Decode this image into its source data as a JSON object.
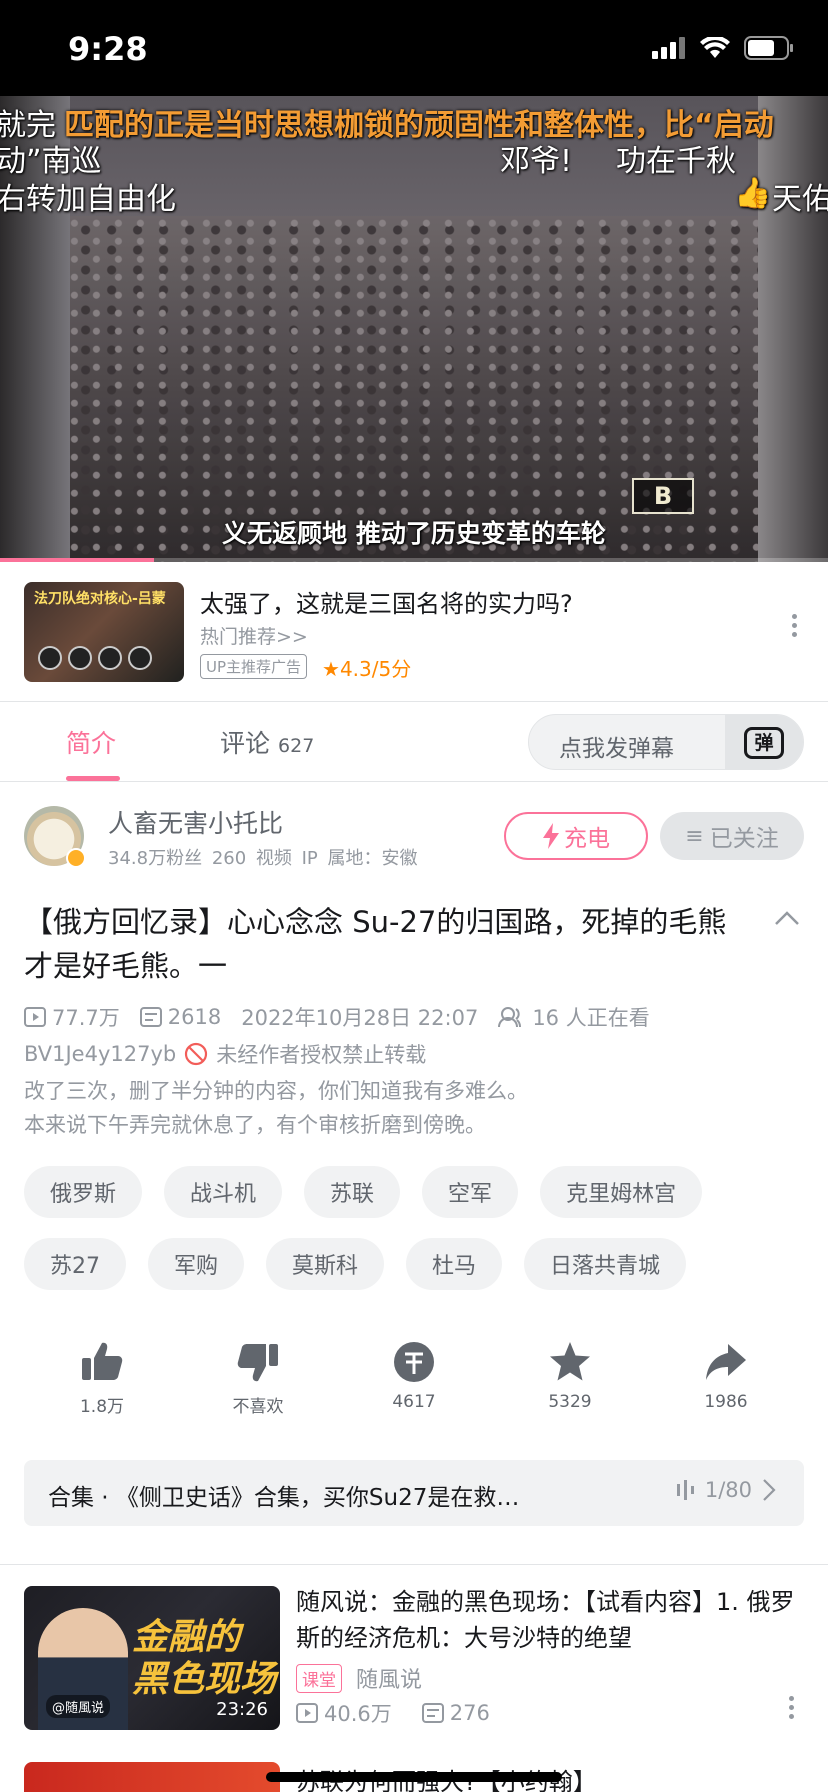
{
  "status_bar": {
    "time": "9:28"
  },
  "video": {
    "danmaku": [
      "就完",
      "匹配的正是当时思想枷锁的顽固性和整体性，比“启动",
      "动”南巡",
      "邓爷!",
      "功在千秋",
      "右转加自由化",
      "天佑"
    ],
    "subtitle": "义无返顾地 推动了历史变革的车轮",
    "channel_logo": "B",
    "progress_fraction": 0.186
  },
  "ad": {
    "thumb_tag": "法刀队绝对核心-吕蒙",
    "title": "太强了，这就是三国名将的实力吗?",
    "subtitle": "热门推荐>>",
    "badge": "UP主推荐广告",
    "rating": "4.3/5分"
  },
  "tabs": {
    "intro": "简介",
    "comments": "评论",
    "comments_count": "627",
    "danmu_placeholder": "点我发弹幕",
    "danmu_button": "弹"
  },
  "uploader": {
    "name": "人畜无害小托比",
    "fans": "34.8万粉丝",
    "videos": "260 视频",
    "ip": "IP 属地：安徽",
    "charge_label": "充电",
    "follow_label": "已关注"
  },
  "video_info": {
    "title": "【俄方回忆录】心心念念 Su-27的归国路，死掉的毛熊才是好毛熊。一",
    "views": "77.7万",
    "danmaku_count": "2618",
    "date": "2022年10月28日 22:07",
    "watching": "16 人正在看",
    "bvid": "BV1Je4y127yb",
    "copyright": "未经作者授权禁止转载",
    "desc_lines": [
      "改了三次，删了半分钟的内容，你们知道我有多难么。",
      "本来说下午弄完就休息了，有个审核折磨到傍晚。"
    ]
  },
  "tags": [
    [
      "俄罗斯",
      "战斗机",
      "苏联",
      "空军",
      "克里姆林宫"
    ],
    [
      "苏27",
      "军购",
      "莫斯科",
      "杜马",
      "日落共青城"
    ]
  ],
  "actions": {
    "like": "1.8万",
    "dislike": "不喜欢",
    "coin": "4617",
    "favorite": "5329",
    "share": "1986"
  },
  "collection": {
    "text": "合集 · 《侧卫史话》合集，买你Su27是在救…",
    "episode": "1/80"
  },
  "recommendations": [
    {
      "title": "随风说：金融的黑色现场：【试看内容】1. 俄罗斯的经济危机：大号沙特的绝望",
      "badge": "课堂",
      "author": "随風说",
      "views": "40.6万",
      "danmaku": "276",
      "duration": "23:26",
      "thumb_text_1": "金融的",
      "thumb_text_2": "黑色现场",
      "thumb_handle": "@随風说"
    },
    {
      "title": "苏联为何而强大?【小约翰】"
    }
  ]
}
